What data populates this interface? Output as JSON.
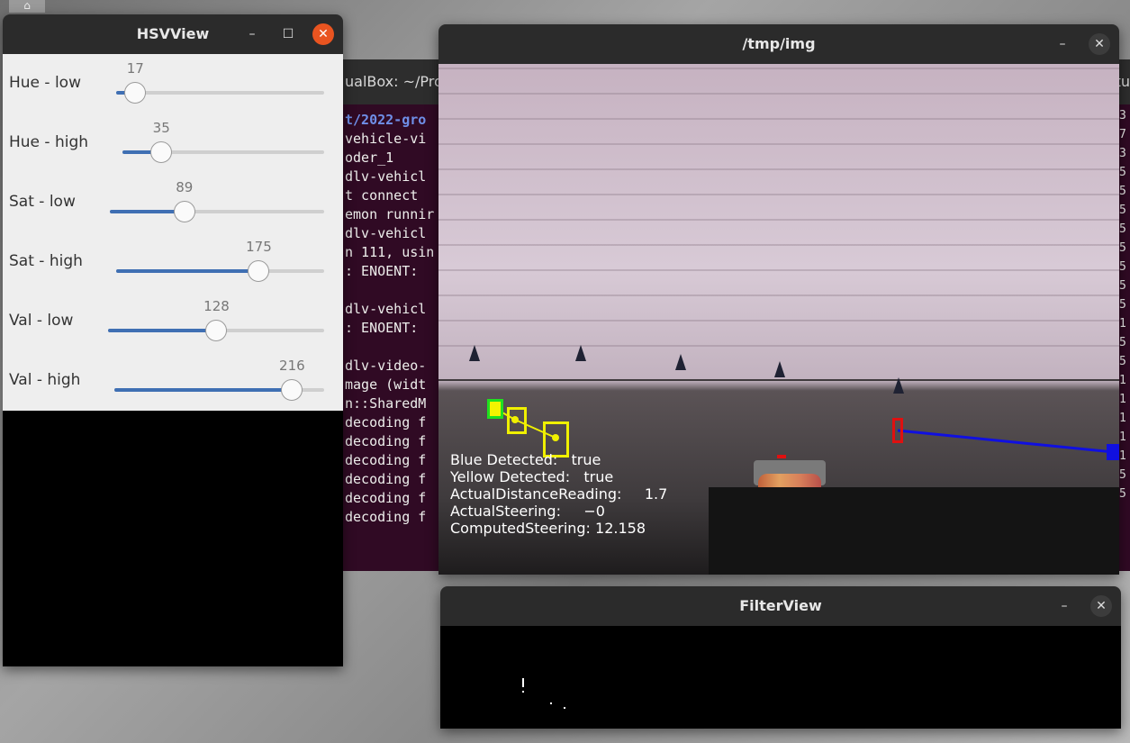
{
  "terminal": {
    "title_fragment": "ualBox: ~/Pro",
    "right_fragment": "tu",
    "lines": [
      "t/2022-gro",
      "vehicle-vi",
      "oder_1",
      "dlv-vehicl",
      "t connect",
      "emon runnir",
      "dlv-vehicl",
      "n 111, usin",
      ": ENOENT:",
      "",
      "dlv-vehicl",
      ": ENOENT:",
      "",
      "dlv-video-",
      "mage (widt",
      "n::SharedM",
      "decoding f",
      "decoding f",
      "decoding f",
      "decoding f",
      "decoding f",
      "decoding f"
    ],
    "right_column": [
      "3",
      "7",
      "3",
      "5",
      "5",
      "5",
      "5",
      "5",
      "5",
      "5",
      "5",
      "1",
      "5",
      "5",
      "1",
      "1",
      "1",
      "1",
      "1",
      "5",
      "5"
    ]
  },
  "hsv_window": {
    "title": "HSVView",
    "sliders": [
      {
        "label": "Hue - low",
        "value": "17",
        "fraction": 0.092
      },
      {
        "label": "Hue - high",
        "value": "35",
        "fraction": 0.193
      },
      {
        "label": "Sat - low",
        "value": "89",
        "fraction": 0.348
      },
      {
        "label": "Sat - high",
        "value": "175",
        "fraction": 0.686
      },
      {
        "label": "Val - low",
        "value": "128",
        "fraction": 0.502
      },
      {
        "label": "Val - high",
        "value": "216",
        "fraction": 0.847
      }
    ]
  },
  "img_window": {
    "title": "/tmp/img",
    "overlay": [
      "Blue Detected:   true",
      "Yellow Detected:   true",
      "ActualDistanceReading:     1.7",
      "ActualSteering:     −0",
      "ComputedSteering: 12.158"
    ]
  },
  "filter_window": {
    "title": "FilterView"
  },
  "colors": {
    "terminal_bg": "#300a24",
    "titlebar": "#2b2b2b",
    "close_orange": "#e95420",
    "slider_fill": "#3f6fb3"
  }
}
